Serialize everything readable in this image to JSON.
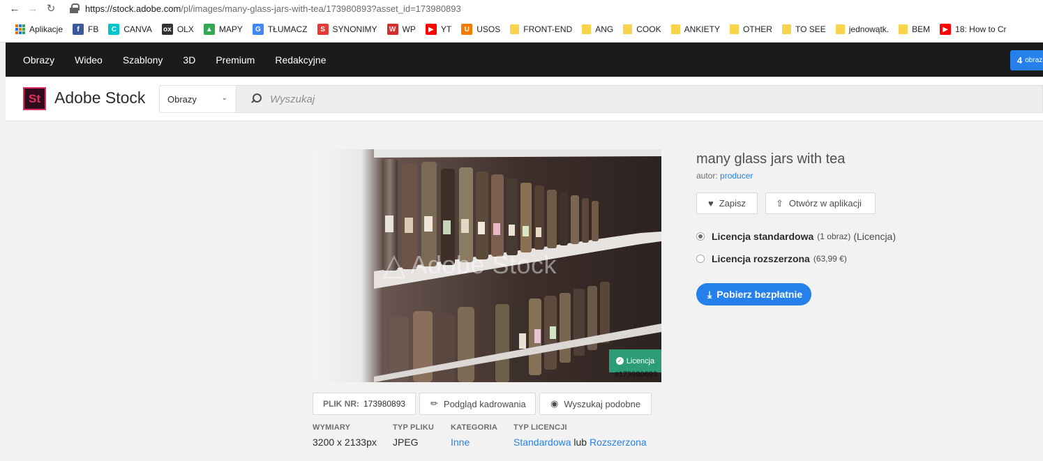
{
  "browser": {
    "url_host": "https://stock.adobe.com",
    "url_path": "/pl/images/many-glass-jars-with-tea/173980893?asset_id=173980893"
  },
  "bookmarks": [
    {
      "label": "Aplikacje",
      "icon": "apps-grid-icon"
    },
    {
      "label": "FB",
      "icon": "facebook-icon",
      "color": "#3b5998",
      "glyph": "f"
    },
    {
      "label": "CANVA",
      "icon": "canva-icon",
      "color": "#00c4cc",
      "glyph": "C"
    },
    {
      "label": "OLX",
      "icon": "olx-icon",
      "color": "#333333",
      "glyph": "ox"
    },
    {
      "label": "MAPY",
      "icon": "maps-icon",
      "color": "#34a853",
      "glyph": "▲"
    },
    {
      "label": "TŁUMACZ",
      "icon": "translate-icon",
      "color": "#4285f4",
      "glyph": "G"
    },
    {
      "label": "SYNONIMY",
      "icon": "synonimy-icon",
      "color": "#e53935",
      "glyph": "S"
    },
    {
      "label": "WP",
      "icon": "wp-icon",
      "color": "#d32f2f",
      "glyph": "W"
    },
    {
      "label": "YT",
      "icon": "youtube-icon",
      "color": "#ff0000",
      "glyph": "▶"
    },
    {
      "label": "USOS",
      "icon": "usos-icon",
      "color": "#f57c00",
      "glyph": "U"
    },
    {
      "label": "FRONT-END",
      "icon": "folder-icon"
    },
    {
      "label": "ANG",
      "icon": "folder-icon"
    },
    {
      "label": "COOK",
      "icon": "folder-icon"
    },
    {
      "label": "ANKIETY",
      "icon": "folder-icon"
    },
    {
      "label": "OTHER",
      "icon": "folder-icon"
    },
    {
      "label": "TO SEE",
      "icon": "folder-icon"
    },
    {
      "label": "jednowątk.",
      "icon": "folder-icon"
    },
    {
      "label": "BEM",
      "icon": "folder-icon"
    },
    {
      "label": "18: How to Cr",
      "icon": "youtube-icon",
      "color": "#ff0000",
      "glyph": "▶"
    }
  ],
  "topnav": {
    "items": [
      "Obrazy",
      "Wideo",
      "Szablony",
      "3D",
      "Premium",
      "Redakcyjne"
    ],
    "cart_count": "4",
    "cart_label": "obraz"
  },
  "header": {
    "logo_mark": "St",
    "logo_text": "Adobe Stock",
    "type_select": "Obrazy",
    "search_placeholder": "Wyszukaj"
  },
  "image": {
    "watermark": "Adobe Stock",
    "license_badge": "Licencja",
    "asset_number": "#173980893"
  },
  "file_buttons": {
    "file_label": "PLIK NR:",
    "file_number": "173980893",
    "crop_preview": "Podgląd kadrowania",
    "find_similar": "Wyszukaj podobne"
  },
  "meta": {
    "dimensions": {
      "label": "WYMIARY",
      "value": "3200 x 2133px"
    },
    "file_type": {
      "label": "TYP PLIKU",
      "value": "JPEG"
    },
    "category": {
      "label": "KATEGORIA",
      "value": "Inne"
    },
    "license_type": {
      "label": "TYP LICENCJI",
      "standard": "Standardowa",
      "or": "lub",
      "extended": "Rozszerzona"
    }
  },
  "details": {
    "title": "many glass jars with tea",
    "author_label": "autor:",
    "author_name": "producer",
    "save_label": "Zapisz",
    "open_in_app_label": "Otwórz w aplikacji",
    "license_standard": {
      "name": "Licencja standardowa",
      "qty": "(1 obraz)",
      "paren": "(Licencja)",
      "selected": true
    },
    "license_extended": {
      "name": "Licencja rozszerzona",
      "price": "(63,99 €)",
      "selected": false
    },
    "download_label": "Pobierz bezpłatnie"
  },
  "colors": {
    "accent": "#2680eb",
    "license_green": "#2d9d78",
    "nav_dark": "#1b1b1b"
  }
}
